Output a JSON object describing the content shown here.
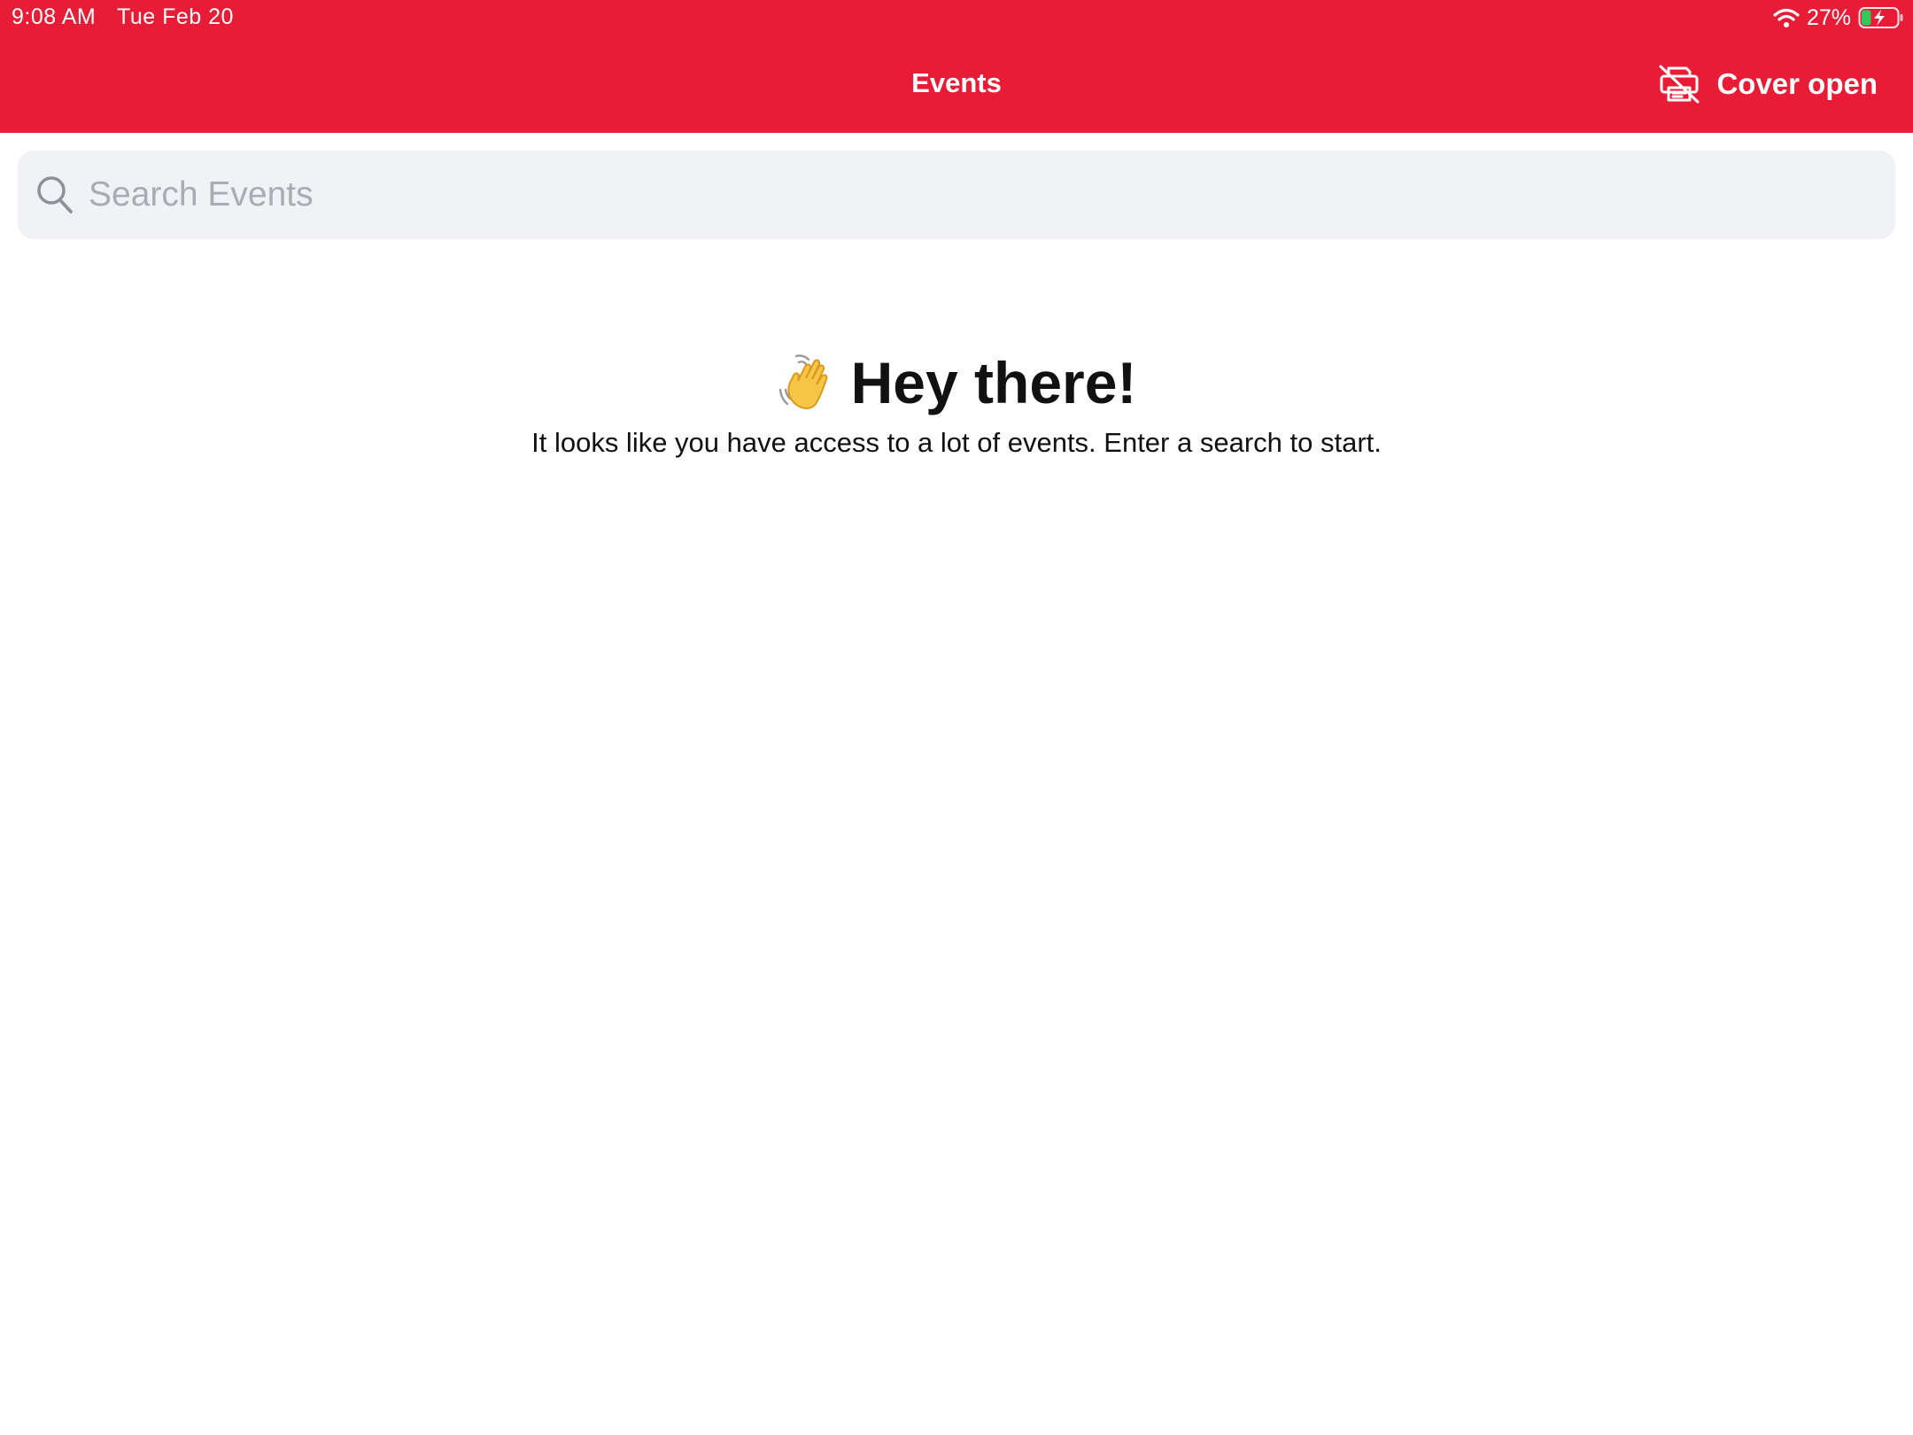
{
  "status_bar": {
    "time": "9:08 AM",
    "date": "Tue Feb 20",
    "battery_percent": "27%",
    "battery_level": 0.27,
    "charging": true,
    "icons": [
      "wifi-icon",
      "battery-charging-icon"
    ]
  },
  "header": {
    "title": "Events",
    "cover_button": {
      "label": "Cover open",
      "icon": "printer-off-icon"
    }
  },
  "search": {
    "placeholder": "Search Events",
    "value": "",
    "icon": "search-icon"
  },
  "empty_state": {
    "icon": "waving-hand-icon",
    "heading": "Hey there!",
    "message": "It looks like you have access to a lot of events. Enter a search to start."
  },
  "colors": {
    "brand_red": "#e81c37",
    "search_bg": "#f1f2f5",
    "placeholder": "#a9acb3",
    "battery_green": "#34c759"
  }
}
